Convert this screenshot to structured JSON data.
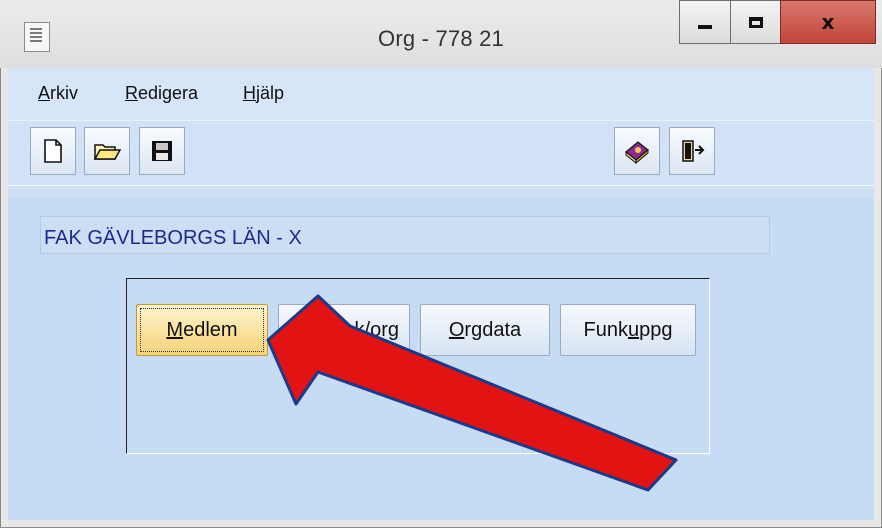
{
  "window": {
    "title": "Org - 778  21",
    "controls": {
      "minimize": "minimize",
      "maximize": "maximize",
      "close": "x"
    }
  },
  "menu": {
    "items": [
      {
        "label_ul": "A",
        "label_rest": "rkiv"
      },
      {
        "label_ul": "R",
        "label_rest": "edigera"
      },
      {
        "label_ul": "H",
        "label_rest": "jälp"
      }
    ]
  },
  "toolbar": {
    "buttons": [
      "new-document-icon",
      "open-folder-icon",
      "save-icon",
      "help-book-icon",
      "exit-door-icon"
    ]
  },
  "org": {
    "name": "FAK GÄVLEBORGS LÄN - X"
  },
  "nav": {
    "medlem": {
      "ul": "M",
      "rest": "edlem"
    },
    "lokorg": {
      "pre": "",
      "visible": "k/org"
    },
    "orgdata": {
      "ul": "O",
      "rest": "rgdata"
    },
    "funkuppg": {
      "pre": "Funk",
      "ul": "u",
      "rest": "ppg"
    }
  },
  "annotation": {
    "color": "#e31313",
    "outline": "#1a3a8a"
  }
}
